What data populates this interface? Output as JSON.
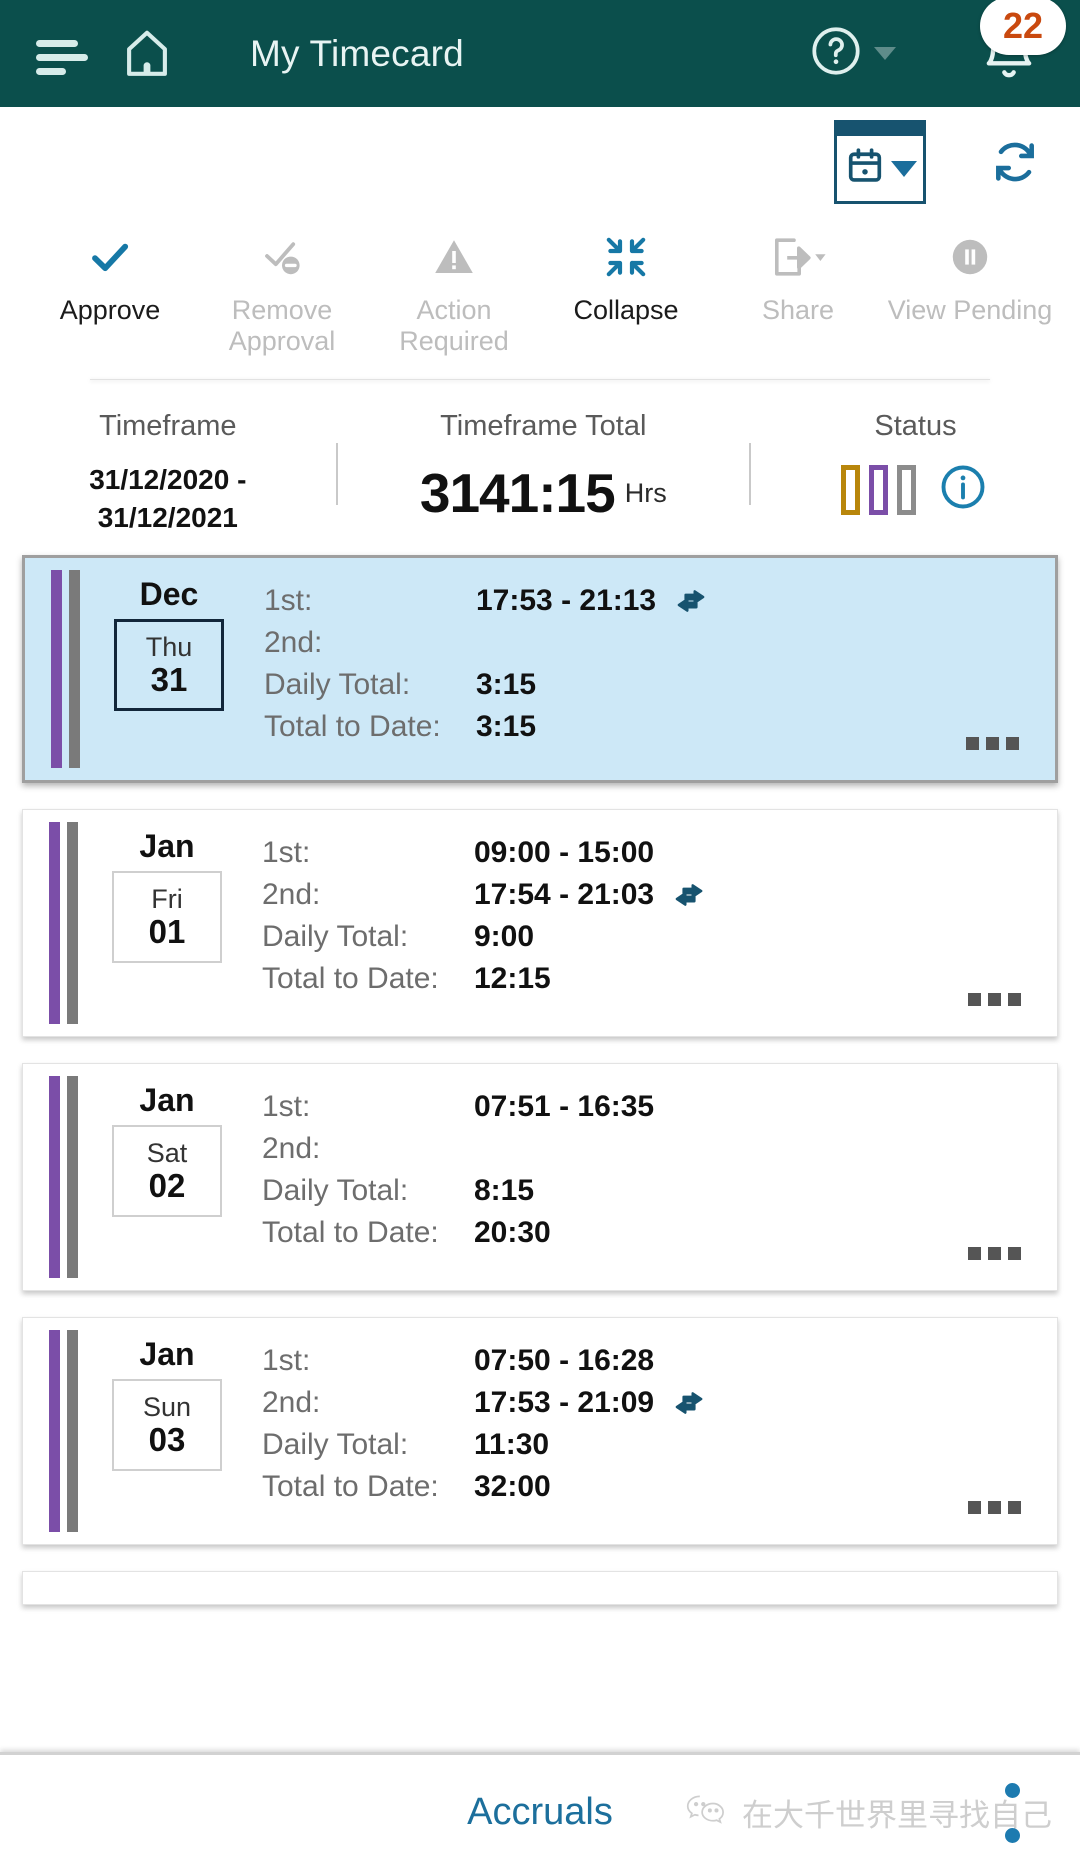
{
  "appbar": {
    "menu_icon": "hamburger-icon",
    "home_icon": "home-icon",
    "title": "My Timecard",
    "help_icon": "help-circle-icon",
    "help_caret": "chevron-down-icon",
    "notifications_icon": "bell-icon",
    "notification_count": "22",
    "bg_color": "#0b4f4c"
  },
  "subheader": {
    "calendar_icon": "calendar-icon",
    "calendar_caret": "chevron-down-icon",
    "refresh_icon": "refresh-icon",
    "accent_color": "#17536f"
  },
  "toolbar": {
    "actions": [
      {
        "label": "Approve",
        "icon": "check-icon",
        "enabled": true
      },
      {
        "label": "Remove Approval",
        "icon": "check-minus-icon",
        "enabled": false
      },
      {
        "label": "Action Required",
        "icon": "warning-triangle-icon",
        "enabled": false
      },
      {
        "label": "Collapse",
        "icon": "collapse-arrows-icon",
        "enabled": true
      },
      {
        "label": "Share",
        "icon": "share-icon",
        "enabled": false
      },
      {
        "label": "View Pending",
        "icon": "pause-circle-icon",
        "enabled": false
      }
    ]
  },
  "summary": {
    "timeframe_label": "Timeframe",
    "timeframe_start": "31/12/2020 -",
    "timeframe_end": "31/12/2021",
    "total_label": "Timeframe Total",
    "total_value": "3141:15",
    "total_unit": "Hrs",
    "status_label": "Status",
    "status_colors": [
      "#b8860b",
      "#7b4ea8",
      "#8c8c8c"
    ],
    "info_icon": "info-circle-icon"
  },
  "day_cards": [
    {
      "month": "Dec",
      "weekday": "Thu",
      "day": "31",
      "selected": true,
      "rows": [
        {
          "label": "1st:",
          "value": "17:53  -  21:13",
          "swap": true
        },
        {
          "label": "2nd:",
          "value": "",
          "swap": false
        },
        {
          "label": "Daily Total:",
          "value": "3:15",
          "swap": false
        },
        {
          "label": "Total to Date:",
          "value": "3:15",
          "swap": false
        }
      ],
      "more_icon": "more-options-icon"
    },
    {
      "month": "Jan",
      "weekday": "Fri",
      "day": "01",
      "selected": false,
      "rows": [
        {
          "label": "1st:",
          "value": "09:00  -  15:00",
          "swap": false
        },
        {
          "label": "2nd:",
          "value": "17:54  -  21:03",
          "swap": true
        },
        {
          "label": "Daily Total:",
          "value": "9:00",
          "swap": false
        },
        {
          "label": "Total to Date:",
          "value": "12:15",
          "swap": false
        }
      ],
      "more_icon": "more-options-icon"
    },
    {
      "month": "Jan",
      "weekday": "Sat",
      "day": "02",
      "selected": false,
      "rows": [
        {
          "label": "1st:",
          "value": "07:51  -  16:35",
          "swap": false
        },
        {
          "label": "2nd:",
          "value": "",
          "swap": false
        },
        {
          "label": "Daily Total:",
          "value": "8:15",
          "swap": false
        },
        {
          "label": "Total to Date:",
          "value": "20:30",
          "swap": false
        }
      ],
      "more_icon": "more-options-icon"
    },
    {
      "month": "Jan",
      "weekday": "Sun",
      "day": "03",
      "selected": false,
      "rows": [
        {
          "label": "1st:",
          "value": "07:50  -  16:28",
          "swap": false
        },
        {
          "label": "2nd:",
          "value": "17:53  -  21:09",
          "swap": true
        },
        {
          "label": "Daily Total:",
          "value": "11:30",
          "swap": false
        },
        {
          "label": "Total to Date:",
          "value": "32:00",
          "swap": false
        }
      ],
      "more_icon": "more-options-icon"
    }
  ],
  "bottombar": {
    "accruals_label": "Accruals",
    "watermark_icon": "wechat-icon",
    "watermark_text": "在大千世界里寻找自己",
    "accent_color": "#1c6f9c"
  }
}
